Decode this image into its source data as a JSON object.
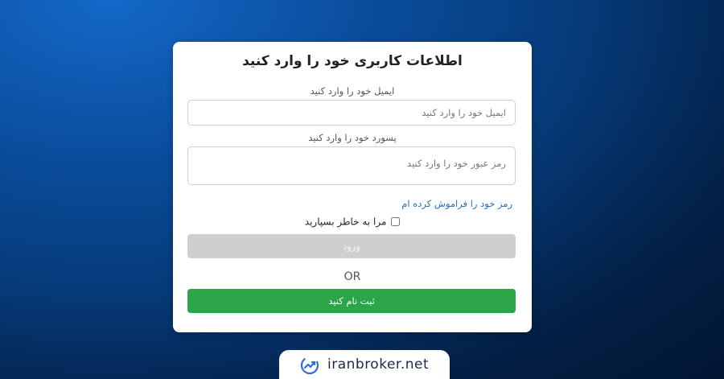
{
  "form": {
    "title": "اطلاعات کاربری خود را وارد کنید",
    "email_label": "ایمیل خود را وارد کنید",
    "email_placeholder": "ایمیل خود را وارد کنید",
    "email_value": "",
    "password_label": "پسورد خود را وارد کنید",
    "password_placeholder": "رمز عبور خود را وارد کنید",
    "password_value": "",
    "forgot_link": "رمز خود را فراموش کرده ام",
    "remember_label": "مرا به خاطر بسپارید",
    "remember_checked": false,
    "login_button": "ورود",
    "or_text": "OR",
    "signup_button": "ثبت نام کنید"
  },
  "colors": {
    "signup": "#2ba548",
    "login_disabled": "#cfcfcf",
    "link": "#2a6fb5",
    "background": "#063a78"
  },
  "brand": {
    "text": "iranbroker.net",
    "icon": "trend-chart-logo-icon"
  }
}
